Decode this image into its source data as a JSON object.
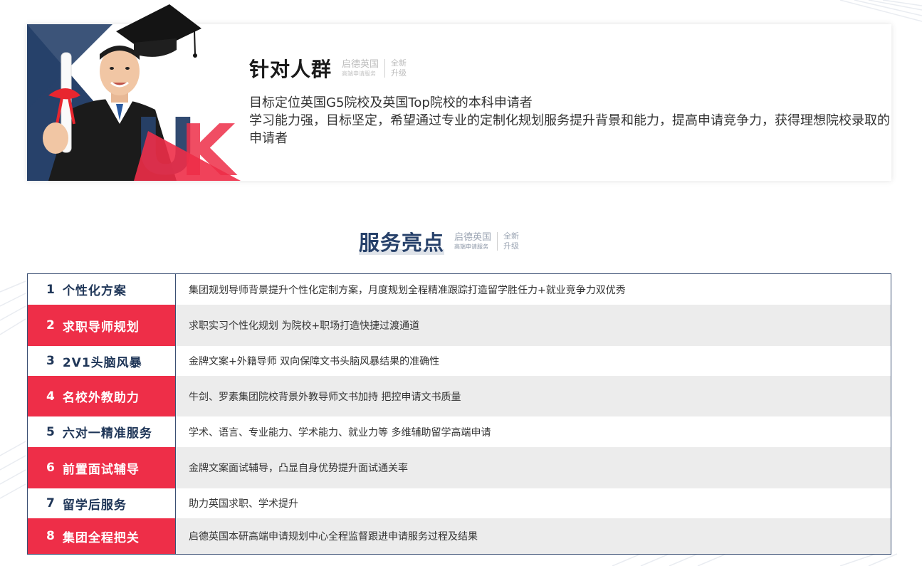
{
  "audience": {
    "title": "针对人群",
    "brand_name": "启德英国",
    "brand_sub": "高端申请服务",
    "brand_tag_1": "全新",
    "brand_tag_2": "升级",
    "lines": [
      "目标定位英国G5院校及英国Top院校的本科申请者",
      "学习能力强，目标坚定，希望通过专业的定制化规划服务提升背景和能力，提高申请竞争力，获得理想院校录取的申请者"
    ],
    "photo_text": "UK"
  },
  "highlights": {
    "title": "服务亮点",
    "brand_name": "启德英国",
    "brand_sub": "高端申请服务",
    "brand_tag_1": "全新",
    "brand_tag_2": "升级",
    "rows": [
      {
        "num": "1",
        "label": "个性化方案",
        "desc": "集团规划导师背景提升个性化定制方案，月度规划全程精准跟踪打造留学胜任力+就业竞争力双优秀"
      },
      {
        "num": "2",
        "label": "求职导师规划",
        "desc": "求职实习个性化规划 为院校+职场打造快捷过渡通道"
      },
      {
        "num": "3",
        "label": "2V1头脑风暴",
        "desc": "金牌文案+外籍导师 双向保障文书头脑风暴结果的准确性"
      },
      {
        "num": "4",
        "label": "名校外教助力",
        "desc": "牛剑、罗素集团院校背景外教导师文书加持 把控申请文书质量"
      },
      {
        "num": "5",
        "label": "六对一精准服务",
        "desc": "学术、语言、专业能力、学术能力、就业力等 多维辅助留学高端申请"
      },
      {
        "num": "6",
        "label": "前置面试辅导",
        "desc": "金牌文案面试辅导，凸显自身优势提升面试通关率"
      },
      {
        "num": "7",
        "label": "留学后服务",
        "desc": "助力英国求职、学术提升"
      },
      {
        "num": "8",
        "label": "集团全程把关",
        "desc": "启德英国本研高端申请规划中心全程监督跟进申请服务过程及结果"
      }
    ]
  },
  "colors": {
    "navy": "#27416a",
    "red": "#ee2e48",
    "row_gray": "#ececec"
  }
}
